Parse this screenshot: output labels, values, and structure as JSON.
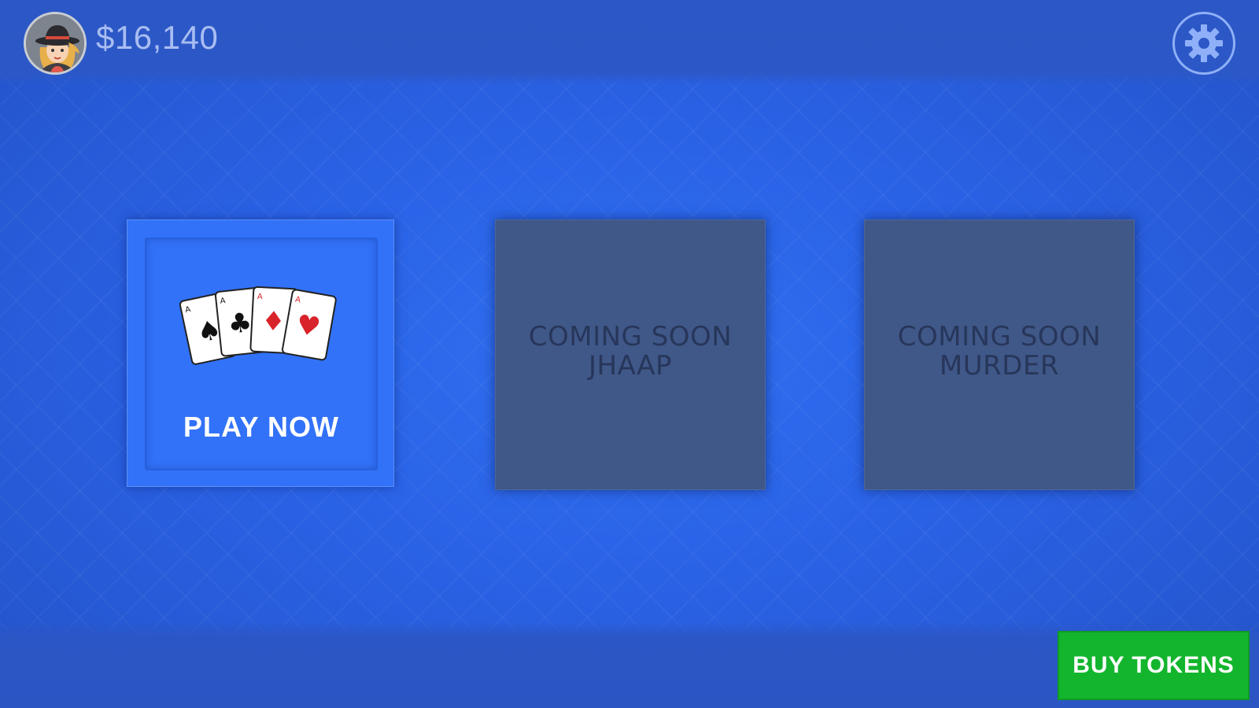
{
  "header": {
    "balance": "$16,140",
    "avatar_icon": "player-avatar",
    "settings_icon": "gear-icon"
  },
  "tiles": [
    {
      "label": "PLAY NOW",
      "icon": "playing-cards-icon",
      "suits": [
        "♠",
        "♣",
        "♦",
        "♥"
      ],
      "rank": "A"
    },
    {
      "line1": "COMING SOON",
      "line2": "JHAAP"
    },
    {
      "line1": "COMING SOON",
      "line2": "MURDER"
    }
  ],
  "footer": {
    "buy_label": "BUY TOKENS"
  },
  "colors": {
    "background": "#2a62e6",
    "play_tile": "#3272f8",
    "disabled_tile": "#405888",
    "buy_button": "#13b52d"
  }
}
